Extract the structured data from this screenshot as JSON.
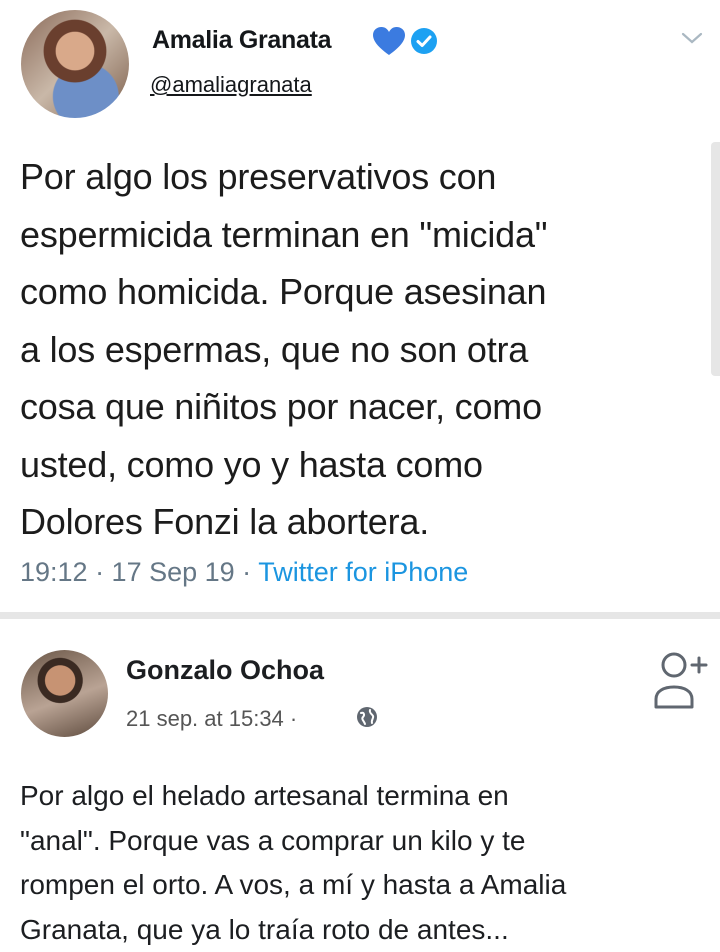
{
  "tweet": {
    "author_name": "Amalia Granata",
    "handle": "@amaliagranata",
    "text_lines": [
      "Por algo los preservativos con",
      "espermicida terminan en \"micida\"",
      "como homicida. Porque asesinan",
      "a los espermas, que no son otra",
      "cosa que niñitos por nacer, como",
      "usted, como yo y hasta como",
      "Dolores Fonzi la abortera."
    ],
    "time": "19:12 · 17 Sep 19 · ",
    "source": "Twitter for iPhone",
    "icons": [
      "blue-heart-icon",
      "verified-badge-icon",
      "chevron-down-icon"
    ],
    "colors": {
      "heart": "#3b7be0",
      "verified": "#1da1f2",
      "link": "#1b95e0",
      "meta": "#657786"
    }
  },
  "post": {
    "author_name": "Gonzalo Ochoa",
    "time": "21 sep. at 15:34 · ",
    "text_lines": [
      "Por algo el helado artesanal termina en",
      "\"anal\". Porque vas a comprar un kilo y te",
      "rompen el orto. A vos, a mí y hasta a Amalia",
      "Granata, que ya lo traía roto de antes..."
    ],
    "icons": [
      "globe-icon",
      "add-friend-icon"
    ]
  }
}
